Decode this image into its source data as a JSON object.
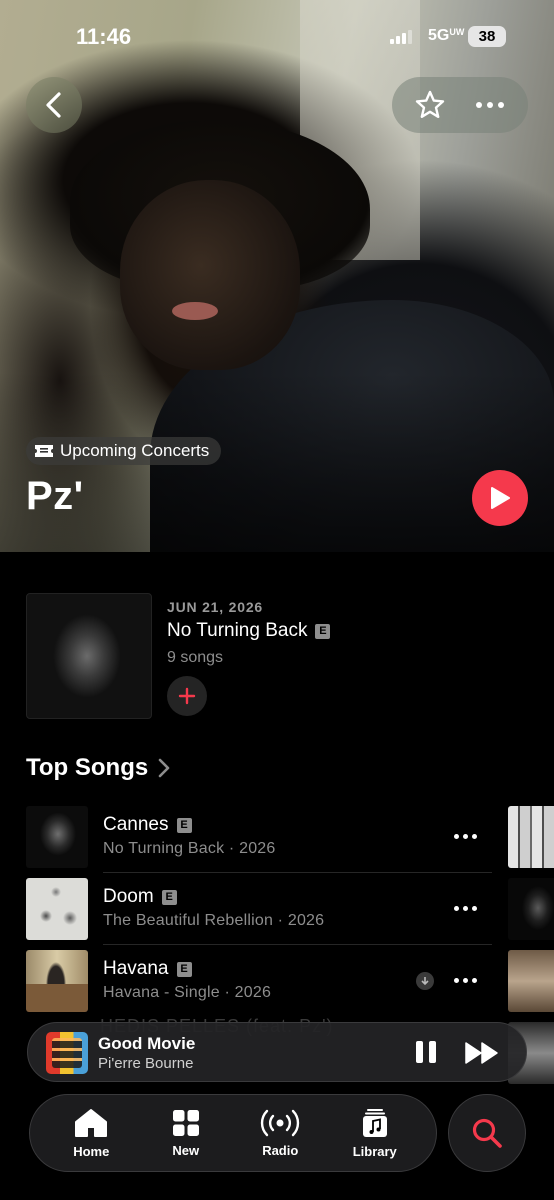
{
  "status_bar": {
    "time": "11:46",
    "network": "5G",
    "network_suffix": "UW",
    "battery": "38"
  },
  "hero": {
    "badge_icon": "ticket-icon",
    "badge_label": "Upcoming Concerts",
    "artist_name": "Pz'"
  },
  "latest_release": {
    "date": "JUN 21, 2026",
    "title": "No Turning Back",
    "explicit": "E",
    "song_count": "9 songs"
  },
  "top_songs": {
    "header": "Top Songs",
    "items": [
      {
        "title": "Cannes",
        "explicit": "E",
        "subtitle": "No Turning Back · 2026"
      },
      {
        "title": "Doom",
        "explicit": "E",
        "subtitle": "The Beautiful Rebellion · 2026"
      },
      {
        "title": "Havana",
        "explicit": "E",
        "subtitle": "Havana - Single · 2026",
        "downloaded": true
      }
    ]
  },
  "behind_player_text": "HEDIS PELLES (feat. Pz')",
  "now_playing": {
    "title": "Good Movie",
    "artist": "Pi'erre Bourne"
  },
  "tabs": [
    {
      "label": "Home",
      "icon": "home-icon",
      "active": true
    },
    {
      "label": "New",
      "icon": "grid-icon"
    },
    {
      "label": "Radio",
      "icon": "radio-icon"
    },
    {
      "label": "Library",
      "icon": "library-icon"
    }
  ],
  "colors": {
    "accent": "#f5394c",
    "background": "#000000",
    "secondary_text": "#8d8d8d"
  }
}
